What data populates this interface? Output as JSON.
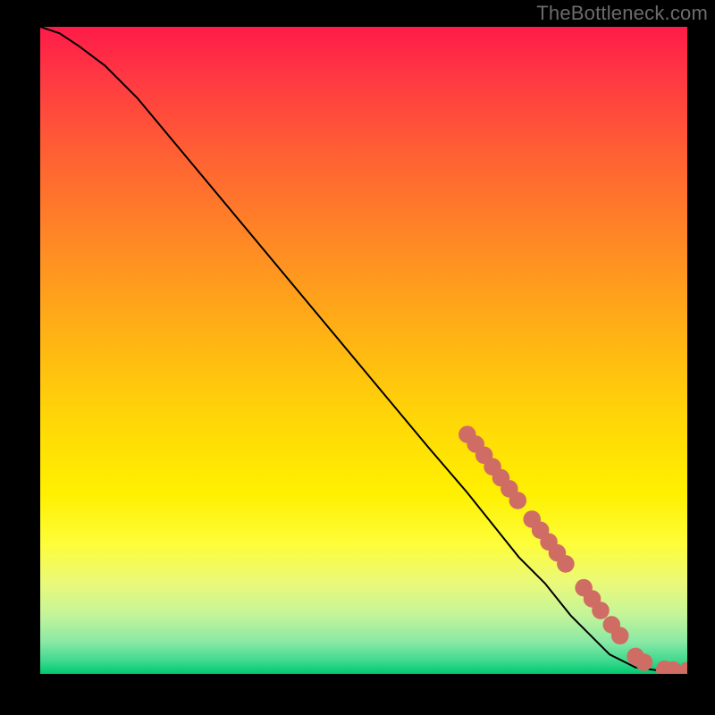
{
  "attribution": "TheBottleneck.com",
  "chart_data": {
    "type": "line",
    "title": "",
    "xlabel": "",
    "ylabel": "",
    "xlim": [
      0,
      100
    ],
    "ylim": [
      0,
      100
    ],
    "series": [
      {
        "name": "curve",
        "x": [
          0,
          3,
          6,
          10,
          15,
          20,
          30,
          40,
          50,
          60,
          66,
          70,
          74,
          78,
          82,
          85,
          88,
          90,
          92,
          95,
          97,
          100
        ],
        "y": [
          100,
          99,
          97,
          94,
          89,
          83,
          71,
          59,
          47,
          35,
          28,
          23,
          18,
          14,
          9,
          6,
          3,
          2,
          1,
          0.6,
          0.5,
          0.5
        ]
      }
    ],
    "markers": [
      {
        "x": 66.0,
        "y": 37.0
      },
      {
        "x": 67.3,
        "y": 35.5
      },
      {
        "x": 68.6,
        "y": 33.8
      },
      {
        "x": 69.9,
        "y": 32.0
      },
      {
        "x": 71.2,
        "y": 30.3
      },
      {
        "x": 72.5,
        "y": 28.6
      },
      {
        "x": 73.8,
        "y": 26.8
      },
      {
        "x": 76.0,
        "y": 23.9
      },
      {
        "x": 77.3,
        "y": 22.2
      },
      {
        "x": 78.6,
        "y": 20.4
      },
      {
        "x": 79.9,
        "y": 18.7
      },
      {
        "x": 81.2,
        "y": 17.0
      },
      {
        "x": 84.0,
        "y": 13.3
      },
      {
        "x": 85.3,
        "y": 11.6
      },
      {
        "x": 86.6,
        "y": 9.8
      },
      {
        "x": 88.3,
        "y": 7.6
      },
      {
        "x": 89.6,
        "y": 5.9
      },
      {
        "x": 92.0,
        "y": 2.7
      },
      {
        "x": 93.3,
        "y": 1.8
      },
      {
        "x": 96.5,
        "y": 0.7
      },
      {
        "x": 97.8,
        "y": 0.6
      },
      {
        "x": 100.0,
        "y": 0.5
      }
    ],
    "gradient_stops": [
      {
        "pct": 0,
        "color": "#ff1b49"
      },
      {
        "pct": 8,
        "color": "#ff3942"
      },
      {
        "pct": 20,
        "color": "#ff6133"
      },
      {
        "pct": 34,
        "color": "#ff8b24"
      },
      {
        "pct": 48,
        "color": "#ffb314"
      },
      {
        "pct": 60,
        "color": "#ffd508"
      },
      {
        "pct": 72,
        "color": "#fff000"
      },
      {
        "pct": 80,
        "color": "#fdfd3a"
      },
      {
        "pct": 86,
        "color": "#eaf97a"
      },
      {
        "pct": 91,
        "color": "#c3f49a"
      },
      {
        "pct": 95,
        "color": "#8ae9a5"
      },
      {
        "pct": 98,
        "color": "#3ed98e"
      },
      {
        "pct": 100,
        "color": "#00c96f"
      }
    ]
  }
}
